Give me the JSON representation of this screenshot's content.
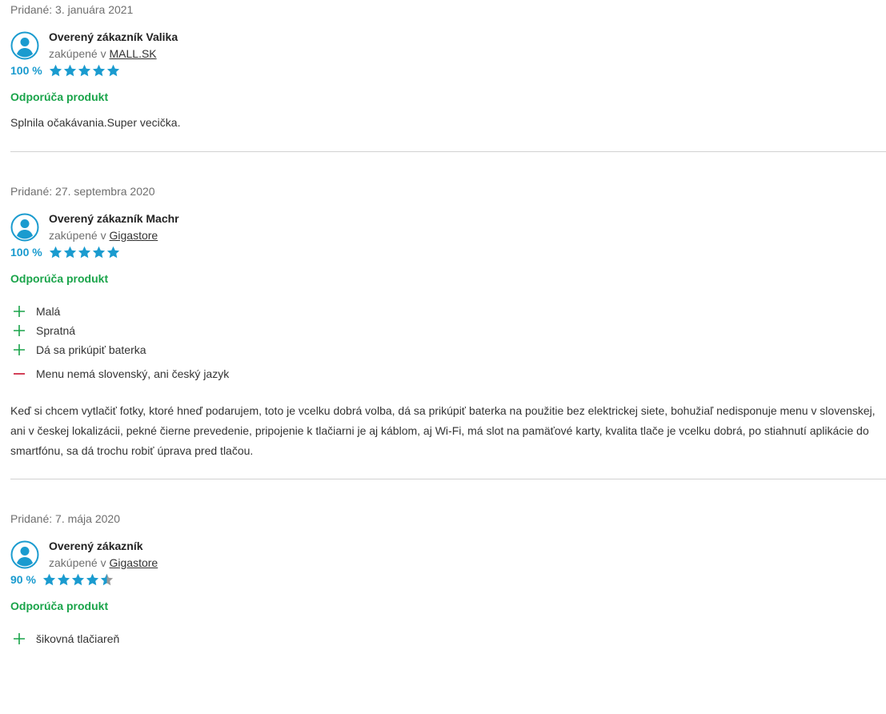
{
  "colors": {
    "accent": "#1a9bcf",
    "star_gray": "#9a9a9a",
    "recommend": "#1aa44a",
    "pro": "#1aa44a",
    "con": "#c8102e",
    "divider": "#d2d2d2"
  },
  "reviews": [
    {
      "date": "Pridané: 3. januára 2021",
      "author": "Overený zákazník Valika",
      "bought_prefix": "zakúpené v ",
      "store": "MALL.SK",
      "rating_pct": "100 %",
      "rating_value": 5,
      "recommend": "Odporúča produkt",
      "pros": [],
      "cons": [],
      "text": "Splnila očakávania.Super vecička."
    },
    {
      "date": "Pridané: 27. septembra 2020",
      "author": "Overený zákazník Machr",
      "bought_prefix": "zakúpené v ",
      "store": "Gigastore",
      "rating_pct": "100 %",
      "rating_value": 5,
      "recommend": "Odporúča produkt",
      "pros": [
        "Malá",
        "Spratná",
        "Dá sa prikúpiť baterka"
      ],
      "cons": [
        "Menu nemá slovenský, ani český jazyk"
      ],
      "text": "Keď si chcem vytlačiť fotky, ktoré hneď podarujem, toto je vcelku dobrá volba, dá sa prikúpiť baterka na použitie bez elektrickej siete, bohužiaľ nedisponuje menu v slovenskej, ani v českej lokalizácii, pekné čierne prevedenie, pripojenie k tlačiarni je aj káblom, aj Wi-Fi, má slot na pamäťové karty, kvalita tlače je vcelku dobrá, po stiahnutí aplikácie do smartfónu, sa dá trochu robiť úprava pred tlačou."
    },
    {
      "date": "Pridané: 7. mája 2020",
      "author": "Overený zákazník",
      "bought_prefix": "zakúpené v ",
      "store": "Gigastore",
      "rating_pct": "90 %",
      "rating_value": 4.5,
      "recommend": "Odporúča produkt",
      "pros": [
        "šikovná tlačiareň"
      ],
      "cons": [],
      "text": ""
    }
  ]
}
